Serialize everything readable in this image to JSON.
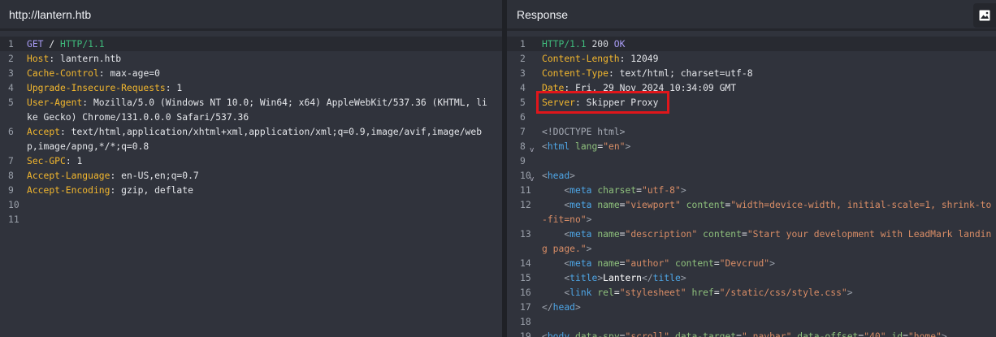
{
  "request": {
    "title": "http://lantern.htb",
    "lines": [
      [
        [
          "method",
          "GET"
        ],
        [
          "punc",
          " / "
        ],
        [
          "ver",
          "HTTP/1.1"
        ]
      ],
      [
        [
          "hname",
          "Host"
        ],
        [
          "punc",
          ": "
        ],
        [
          "val",
          "lantern.htb"
        ]
      ],
      [
        [
          "hname",
          "Cache-Control"
        ],
        [
          "punc",
          ": "
        ],
        [
          "val",
          "max-age=0"
        ]
      ],
      [
        [
          "hname",
          "Upgrade-Insecure-Requests"
        ],
        [
          "punc",
          ": "
        ],
        [
          "val",
          "1"
        ]
      ],
      [
        [
          "hname",
          "User-Agent"
        ],
        [
          "punc",
          ": "
        ],
        [
          "val",
          "Mozilla/5.0 (Windows NT 10.0; Win64; x64) AppleWebKit/537.36 (KHTML, like Gecko) Chrome/131.0.0.0 Safari/537.36"
        ]
      ],
      [
        [
          "hname",
          "Accept"
        ],
        [
          "punc",
          ": "
        ],
        [
          "val",
          "text/html,application/xhtml+xml,application/xml;q=0.9,image/avif,image/webp,image/apng,*/*;q=0.8"
        ]
      ],
      [
        [
          "hname",
          "Sec-GPC"
        ],
        [
          "punc",
          ": "
        ],
        [
          "val",
          "1"
        ]
      ],
      [
        [
          "hname",
          "Accept-Language"
        ],
        [
          "punc",
          ": "
        ],
        [
          "val",
          "en-US,en;q=0.7"
        ]
      ],
      [
        [
          "hname",
          "Accept-Encoding"
        ],
        [
          "punc",
          ": "
        ],
        [
          "val",
          "gzip, deflate"
        ]
      ],
      [],
      []
    ]
  },
  "response": {
    "title": "Response",
    "image_button_icon": "image-icon",
    "highlight_color": "#e0161b",
    "lines": [
      [
        [
          "ver",
          "HTTP/1.1"
        ],
        [
          "status",
          " 200 "
        ],
        [
          "ok",
          "OK"
        ]
      ],
      [
        [
          "hname",
          "Content-Length"
        ],
        [
          "punc",
          ": "
        ],
        [
          "val",
          "12049"
        ]
      ],
      [
        [
          "hname",
          "Content-Type"
        ],
        [
          "punc",
          ": "
        ],
        [
          "val",
          "text/html; charset=utf-8"
        ]
      ],
      [
        [
          "hname",
          "Date"
        ],
        [
          "punc",
          ": "
        ],
        [
          "val",
          "Fri, 29 Nov 2024 10:34:09 GMT"
        ]
      ],
      [
        [
          "hname",
          "Server"
        ],
        [
          "punc",
          ": "
        ],
        [
          "val",
          "Skipper Proxy"
        ]
      ],
      [],
      [
        [
          "doc",
          "<!DOCTYPE html>"
        ]
      ],
      [
        [
          "br",
          "<"
        ],
        [
          "tag",
          "html"
        ],
        [
          "punc",
          " "
        ],
        [
          "attr",
          "lang"
        ],
        [
          "punc",
          "="
        ],
        [
          "str",
          "\"en\""
        ],
        [
          "br",
          ">"
        ]
      ],
      [],
      [
        [
          "br",
          "<"
        ],
        [
          "tag",
          "head"
        ],
        [
          "br",
          ">"
        ]
      ],
      [
        [
          "punc",
          "    "
        ],
        [
          "br",
          "<"
        ],
        [
          "tag",
          "meta"
        ],
        [
          "punc",
          " "
        ],
        [
          "attr",
          "charset"
        ],
        [
          "punc",
          "="
        ],
        [
          "str",
          "\"utf-8\""
        ],
        [
          "br",
          ">"
        ]
      ],
      [
        [
          "punc",
          "    "
        ],
        [
          "br",
          "<"
        ],
        [
          "tag",
          "meta"
        ],
        [
          "punc",
          " "
        ],
        [
          "attr",
          "name"
        ],
        [
          "punc",
          "="
        ],
        [
          "str",
          "\"viewport\""
        ],
        [
          "punc",
          " "
        ],
        [
          "attr",
          "content"
        ],
        [
          "punc",
          "="
        ],
        [
          "str",
          "\"width=device-width, initial-scale=1, shrink-to-fit=no\""
        ],
        [
          "br",
          ">"
        ]
      ],
      [
        [
          "punc",
          "    "
        ],
        [
          "br",
          "<"
        ],
        [
          "tag",
          "meta"
        ],
        [
          "punc",
          " "
        ],
        [
          "attr",
          "name"
        ],
        [
          "punc",
          "="
        ],
        [
          "str",
          "\"description\""
        ],
        [
          "punc",
          " "
        ],
        [
          "attr",
          "content"
        ],
        [
          "punc",
          "="
        ],
        [
          "str",
          "\"Start your development with LeadMark landing page.\""
        ],
        [
          "br",
          ">"
        ]
      ],
      [
        [
          "punc",
          "    "
        ],
        [
          "br",
          "<"
        ],
        [
          "tag",
          "meta"
        ],
        [
          "punc",
          " "
        ],
        [
          "attr",
          "name"
        ],
        [
          "punc",
          "="
        ],
        [
          "str",
          "\"author\""
        ],
        [
          "punc",
          " "
        ],
        [
          "attr",
          "content"
        ],
        [
          "punc",
          "="
        ],
        [
          "str",
          "\"Devcrud\""
        ],
        [
          "br",
          ">"
        ]
      ],
      [
        [
          "punc",
          "    "
        ],
        [
          "br",
          "<"
        ],
        [
          "tag",
          "title"
        ],
        [
          "br",
          ">"
        ],
        [
          "text",
          "Lantern"
        ],
        [
          "br",
          "</"
        ],
        [
          "tag",
          "title"
        ],
        [
          "br",
          ">"
        ]
      ],
      [
        [
          "punc",
          "    "
        ],
        [
          "br",
          "<"
        ],
        [
          "tag",
          "link"
        ],
        [
          "punc",
          " "
        ],
        [
          "attr",
          "rel"
        ],
        [
          "punc",
          "="
        ],
        [
          "str",
          "\"stylesheet\""
        ],
        [
          "punc",
          " "
        ],
        [
          "attr",
          "href"
        ],
        [
          "punc",
          "="
        ],
        [
          "str",
          "\"/static/css/style.css\""
        ],
        [
          "br",
          ">"
        ]
      ],
      [
        [
          "br",
          "</"
        ],
        [
          "tag",
          "head"
        ],
        [
          "br",
          ">"
        ]
      ],
      [],
      [
        [
          "br",
          "<"
        ],
        [
          "tag",
          "body"
        ],
        [
          "punc",
          " "
        ],
        [
          "attr",
          "data-spy"
        ],
        [
          "punc",
          "="
        ],
        [
          "str",
          "\"scroll\""
        ],
        [
          "punc",
          " "
        ],
        [
          "attr",
          "data-target"
        ],
        [
          "punc",
          "="
        ],
        [
          "str",
          "\".navbar\""
        ],
        [
          "punc",
          " "
        ],
        [
          "attr",
          "data-offset"
        ],
        [
          "punc",
          "="
        ],
        [
          "str",
          "\"40\""
        ],
        [
          "punc",
          " "
        ],
        [
          "attr",
          "id"
        ],
        [
          "punc",
          "="
        ],
        [
          "str",
          "\"home\""
        ],
        [
          "br",
          ">"
        ]
      ]
    ],
    "folded_lines": [
      8,
      10
    ]
  }
}
